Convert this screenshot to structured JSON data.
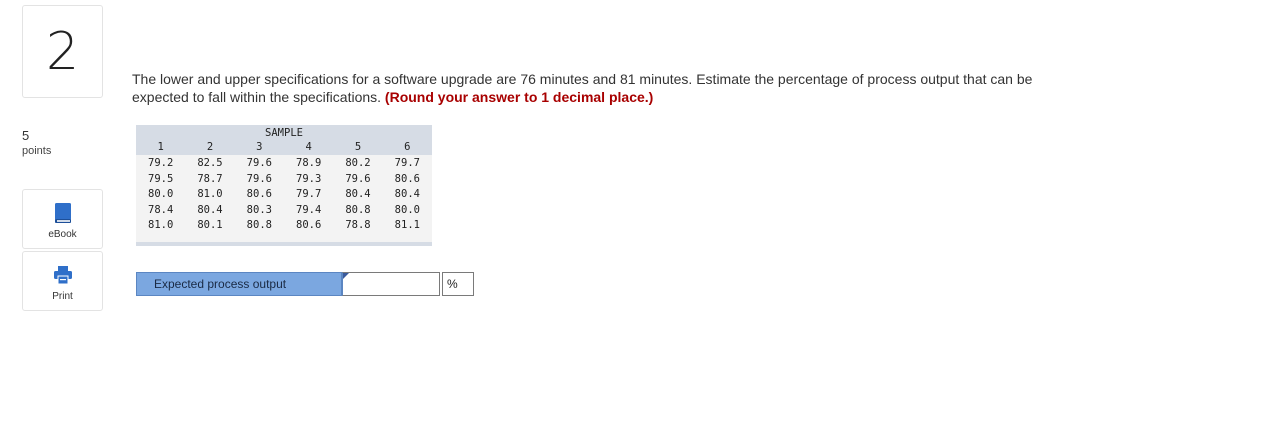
{
  "question": {
    "number": "2",
    "points_value": "5",
    "points_label": "points",
    "text": "The lower and upper specifications for a software upgrade are 76 minutes and 81 minutes. Estimate the percentage of process output that can be expected to fall within the specifications.",
    "instruction": "(Round your answer to 1 decimal place.)"
  },
  "tools": {
    "ebook_label": "eBook",
    "print_label": "Print",
    "ebook_icon": "book-icon",
    "print_icon": "printer-icon"
  },
  "table": {
    "title": "SAMPLE",
    "columns": [
      "1",
      "2",
      "3",
      "4",
      "5",
      "6"
    ],
    "rows": [
      [
        "79.2",
        "82.5",
        "79.6",
        "78.9",
        "80.2",
        "79.7"
      ],
      [
        "79.5",
        "78.7",
        "79.6",
        "79.3",
        "79.6",
        "80.6"
      ],
      [
        "80.0",
        "81.0",
        "80.6",
        "79.7",
        "80.4",
        "80.4"
      ],
      [
        "78.4",
        "80.4",
        "80.3",
        "79.4",
        "80.8",
        "80.0"
      ],
      [
        "81.0",
        "80.1",
        "80.8",
        "80.6",
        "78.8",
        "81.1"
      ]
    ]
  },
  "answer": {
    "label": "Expected process output",
    "value": "",
    "unit": "%"
  },
  "colors": {
    "emphasis": "#a80000",
    "answer_label_bg": "#7ba7e0",
    "table_header_bg": "#d6dce5",
    "icon_blue": "#2f6fc9"
  }
}
